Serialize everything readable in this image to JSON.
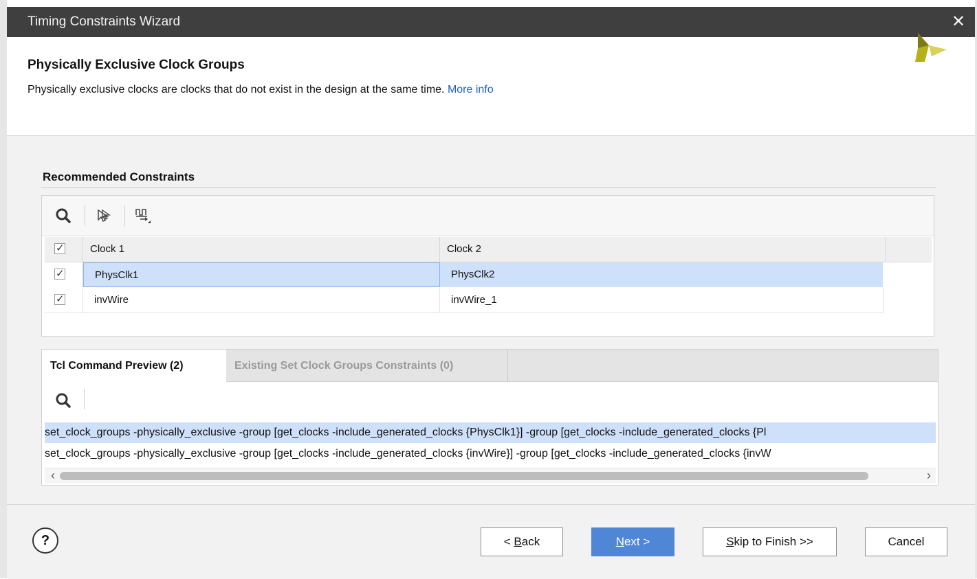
{
  "window": {
    "title": "Timing Constraints Wizard",
    "close_glyph": "✕"
  },
  "header": {
    "title": "Physically Exclusive Clock Groups",
    "description": "Physically exclusive clocks are clocks that do not exist in the design at the same time.",
    "more_info": "More info",
    "logo_colors": [
      "#b5b01c",
      "#d8d25a",
      "#7c7a12"
    ]
  },
  "recommended": {
    "label": "Recommended Constraints",
    "toolbar_icons": [
      "search-icon",
      "cursor-select-icon",
      "clock-waveform-icon"
    ],
    "columns": [
      "Clock 1",
      "Clock 2"
    ],
    "rows": [
      {
        "checked": true,
        "clock1": "PhysClk1",
        "clock2": "PhysClk2",
        "selected": true
      },
      {
        "checked": true,
        "clock1": "invWire",
        "clock2": "invWire_1",
        "selected": false
      }
    ]
  },
  "preview": {
    "tabs": [
      {
        "label": "Tcl Command Preview (2)",
        "active": true
      },
      {
        "label": "Existing Set Clock Groups Constraints (0)",
        "active": false
      }
    ],
    "toolbar_icons": [
      "search-icon"
    ],
    "lines": [
      "set_clock_groups -physically_exclusive -group [get_clocks -include_generated_clocks {PhysClk1}] -group [get_clocks -include_generated_clocks {Pl",
      "set_clock_groups -physically_exclusive -group [get_clocks -include_generated_clocks {invWire}] -group [get_clocks -include_generated_clocks {invW"
    ],
    "scroll_left": "‹",
    "scroll_right": "›"
  },
  "footer": {
    "help_glyph": "?",
    "back_prefix": "< ",
    "back_mnemonic": "B",
    "back_rest": "ack",
    "next_mnemonic": "N",
    "next_rest": "ext >",
    "skip_mnemonic": "S",
    "skip_rest": "kip to Finish >>",
    "cancel": "Cancel"
  },
  "colors": {
    "accent": "#4f86d6",
    "link": "#1f5fd1",
    "selection": "#cfe0fa",
    "titlebar": "#3f3f3f"
  }
}
